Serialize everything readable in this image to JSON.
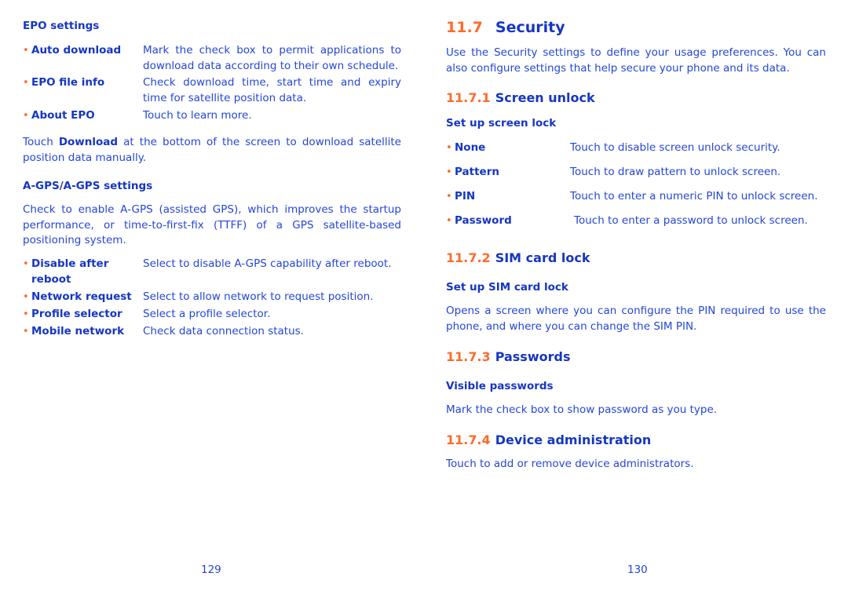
{
  "left_page": {
    "epo": {
      "heading": "EPO settings",
      "items": [
        {
          "term": "Auto download",
          "desc": "Mark the check box to permit applications to download data according to their own schedule."
        },
        {
          "term": "EPO file info",
          "desc": "Check download time, start time and expiry time for satellite position data."
        },
        {
          "term": "About EPO",
          "desc": "Touch to learn more."
        }
      ],
      "note_prefix": "Touch ",
      "note_bold": "Download",
      "note_suffix": " at the bottom of the screen to download satellite position data manually."
    },
    "agps": {
      "heading": "A-GPS/A-GPS settings",
      "intro": "Check to enable A-GPS (assisted GPS), which improves the startup performance, or time-to-first-fix (TTFF) of a GPS satellite-based positioning system.",
      "items": [
        {
          "term": "Disable after reboot",
          "desc": "Select to disable A-GPS capability after reboot."
        },
        {
          "term": "Network request",
          "desc": "Select to allow network to request position."
        },
        {
          "term": "Profile selector",
          "desc": "Select a profile selector."
        },
        {
          "term": "Mobile network",
          "desc": "Check data connection status."
        }
      ]
    },
    "page_number": "129"
  },
  "right_page": {
    "section": {
      "number": "11.7",
      "title": "Security"
    },
    "intro": "Use the Security settings to define your usage preferences. You can also configure settings that help secure your phone and its data.",
    "screen_unlock": {
      "number": "11.7.1",
      "title": "Screen unlock",
      "subheading": "Set up screen lock",
      "items": [
        {
          "term": "None",
          "desc": "Touch to disable screen unlock security."
        },
        {
          "term": "Pattern",
          "desc": "Touch to draw pattern to unlock screen."
        },
        {
          "term": "PIN",
          "desc": "Touch to enter a numeric PIN to unlock screen."
        },
        {
          "term": "Password",
          "desc": "Touch to enter a password to unlock screen."
        }
      ]
    },
    "sim_lock": {
      "number": "11.7.2",
      "title": "SIM card lock",
      "subheading": "Set up SIM card lock",
      "text": "Opens a screen where you can configure the PIN required to use the phone, and where you can change the SIM PIN."
    },
    "passwords": {
      "number": "11.7.3",
      "title": "Passwords",
      "subheading": "Visible passwords",
      "text": "Mark the check box to show password as you type."
    },
    "device_admin": {
      "number": "11.7.4",
      "title": "Device administration",
      "text": "Touch to add or remove device administrators."
    },
    "page_number": "130"
  },
  "colors": {
    "heading_number": "#ff6a2a",
    "heading_text": "#1536c4",
    "body_text": "#2446d8",
    "bullet": "#ff6a2a"
  }
}
